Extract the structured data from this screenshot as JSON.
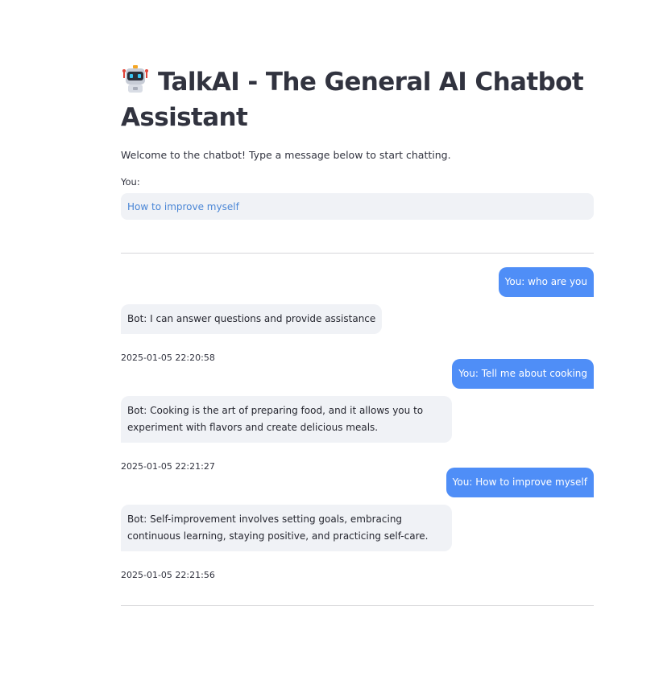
{
  "header": {
    "title": "TalkAI - The General AI Chatbot Assistant",
    "icon": "robot-icon"
  },
  "intro": {
    "welcome": "Welcome to the chatbot! Type a message below to start chatting."
  },
  "input": {
    "label": "You:",
    "value": "How to improve myself"
  },
  "conversation": [
    {
      "user": "You: who are you",
      "bot": "Bot: I can answer questions and provide assistance",
      "timestamp": "2025-01-05 22:20:58"
    },
    {
      "user": "You: Tell me about cooking",
      "bot": "Bot: Cooking is the art of preparing food, and it allows you to experiment with flavors and create delicious meals.",
      "timestamp": "2025-01-05 22:21:27"
    },
    {
      "user": "You: How to improve myself",
      "bot": "Bot: Self-improvement involves setting goals, embracing continuous learning, staying positive, and practicing self-care.",
      "timestamp": "2025-01-05 22:21:56"
    }
  ],
  "colors": {
    "user_bubble": "#4f8ef7",
    "bot_bubble": "#f0f2f6",
    "input_text": "#4a86d6"
  }
}
